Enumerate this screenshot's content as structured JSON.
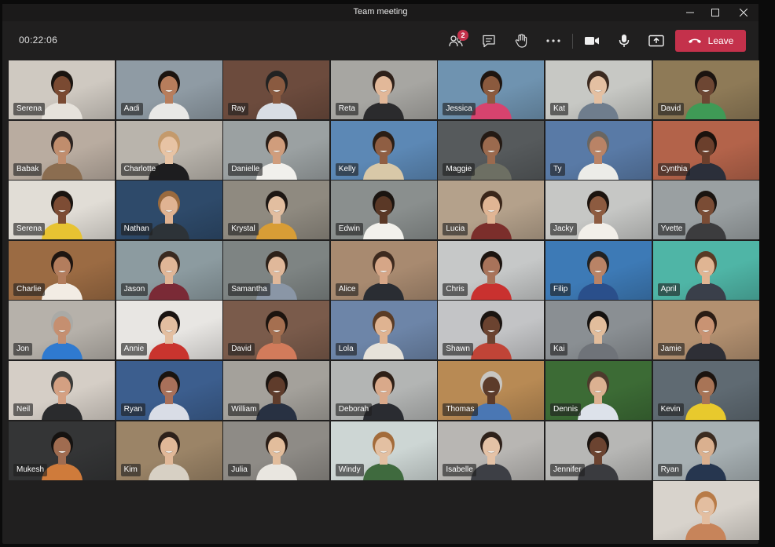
{
  "window": {
    "title": "Team meeting"
  },
  "toolbar": {
    "timer": "00:22:06",
    "participants_badge": "2",
    "leave_label": "Leave"
  },
  "colors": {
    "leave": "#c4314b",
    "badge": "#c4314b",
    "background": "#201f1f"
  },
  "icons": [
    "minimize-icon",
    "maximize-icon",
    "close-icon",
    "participants-icon",
    "chat-icon",
    "raise-hand-icon",
    "more-options-icon",
    "camera-icon",
    "microphone-icon",
    "share-screen-icon",
    "phone-hangup-icon"
  ],
  "participants": [
    {
      "name": "Serena",
      "bg": "#cfc9c1",
      "skin": "#7a4a32",
      "hair": "#1a1410",
      "shirt": "#e6e2db"
    },
    {
      "name": "Aadi",
      "bg": "#8f9ba4",
      "skin": "#b77d5c",
      "hair": "#1c140f",
      "shirt": "#e8e8e6"
    },
    {
      "name": "Ray",
      "bg": "#6c4b3d",
      "skin": "#8a5a40",
      "hair": "#222",
      "shirt": "#d8dde4"
    },
    {
      "name": "Reta",
      "bg": "#a7a6a2",
      "skin": "#e2b899",
      "hair": "#2e2019",
      "shirt": "#2b2b2d"
    },
    {
      "name": "Jessica",
      "bg": "#6f93b0",
      "skin": "#8b5a3e",
      "hair": "#1e1510",
      "shirt": "#d7436e"
    },
    {
      "name": "Kat",
      "bg": "#c7c8c4",
      "skin": "#e4c0a2",
      "hair": "#3b2a20",
      "shirt": "#6f7d8d"
    },
    {
      "name": "David",
      "bg": "#8e7a57",
      "skin": "#6d4633",
      "hair": "#1c1410",
      "shirt": "#3f9a56"
    },
    {
      "name": "Babak",
      "bg": "#b9aca0",
      "skin": "#c08d6d",
      "hair": "#2b2320",
      "shirt": "#8b6d50"
    },
    {
      "name": "Charlotte",
      "bg": "#b9b4ac",
      "skin": "#e7c3a4",
      "hair": "#c49a6c",
      "shirt": "#1d1d1f"
    },
    {
      "name": "Danielle",
      "bg": "#9ba1a2",
      "skin": "#d09d7c",
      "hair": "#2a1d16",
      "shirt": "#f1f0ec"
    },
    {
      "name": "Kelly",
      "bg": "#5c88b5",
      "skin": "#8f5e43",
      "hair": "#2b1e15",
      "shirt": "#d8c8a8"
    },
    {
      "name": "Maggie",
      "bg": "#565a5c",
      "skin": "#9b6a4e",
      "hair": "#241a14",
      "shirt": "#6d6f63"
    },
    {
      "name": "Ty",
      "bg": "#597aa6",
      "skin": "#b98366",
      "hair": "#6a6661",
      "shirt": "#ecece8"
    },
    {
      "name": "Cynthia",
      "bg": "#b3634a",
      "skin": "#6b3f2c",
      "hair": "#1b120d",
      "shirt": "#2b2f3a"
    },
    {
      "name": "Serena",
      "bg": "#e1ddd6",
      "skin": "#7d4c34",
      "hair": "#1a1410",
      "shirt": "#e7c332"
    },
    {
      "name": "Nathan",
      "bg": "#2e4a6a",
      "skin": "#e0b392",
      "hair": "#9a6a3e",
      "shirt": "#2d3338"
    },
    {
      "name": "Krystal",
      "bg": "#8f8a80",
      "skin": "#e2bea0",
      "hair": "#1d1714",
      "shirt": "#d89d36"
    },
    {
      "name": "Edwin",
      "bg": "#8a8f8e",
      "skin": "#5a3826",
      "hair": "#1a1410",
      "shirt": "#f2f1ec"
    },
    {
      "name": "Lucia",
      "bg": "#b4a18b",
      "skin": "#e0b594",
      "hair": "#3a261a",
      "shirt": "#7b2e2b"
    },
    {
      "name": "Jacky",
      "bg": "#c6c7c5",
      "skin": "#8d5b40",
      "hair": "#1c140f",
      "shirt": "#f2efe9"
    },
    {
      "name": "Yvette",
      "bg": "#9aa0a2",
      "skin": "#7a4c35",
      "hair": "#1a1410",
      "shirt": "#3c3c3e"
    },
    {
      "name": "Charlie",
      "bg": "#9b6b43",
      "skin": "#b37d5d",
      "hair": "#1e1510",
      "shirt": "#f2ece4"
    },
    {
      "name": "Jason",
      "bg": "#8c9ba0",
      "skin": "#e0b697",
      "hair": "#3a2a20",
      "shirt": "#7a2a36"
    },
    {
      "name": "Samantha",
      "bg": "#7e8483",
      "skin": "#e0b89a",
      "hair": "#2d2119",
      "shirt": "#8a96a6"
    },
    {
      "name": "Alice",
      "bg": "#a88a70",
      "skin": "#d6a687",
      "hair": "#3d2a1f",
      "shirt": "#2a2d33"
    },
    {
      "name": "Chris",
      "bg": "#c6c8c8",
      "skin": "#a8735a",
      "hair": "#1c140f",
      "shirt": "#c9312f"
    },
    {
      "name": "Filip",
      "bg": "#3d7ab6",
      "skin": "#b98366",
      "hair": "#222",
      "shirt": "#2a4f8b"
    },
    {
      "name": "April",
      "bg": "#4fb5a6",
      "skin": "#e0b593",
      "hair": "#5a3b25",
      "shirt": "#3a3f4a"
    },
    {
      "name": "Jon",
      "bg": "#b6b1aa",
      "skin": "#c58f70",
      "hair": "#aaaaa6",
      "shirt": "#2f7ad0"
    },
    {
      "name": "Annie",
      "bg": "#e8e6e3",
      "skin": "#e3bea0",
      "hair": "#1a1412",
      "shirt": "#c9342e"
    },
    {
      "name": "David",
      "bg": "#7a5b4b",
      "skin": "#a56f50",
      "hair": "#1c140f",
      "shirt": "#d27b5b"
    },
    {
      "name": "Lola",
      "bg": "#6d85a8",
      "skin": "#dfb391",
      "hair": "#5b3c25",
      "shirt": "#e6e2da"
    },
    {
      "name": "Shawn",
      "bg": "#c3c4c6",
      "skin": "#6b4330",
      "hair": "#1a1410",
      "shirt": "#c04437"
    },
    {
      "name": "Kai",
      "bg": "#8a8f93",
      "skin": "#e2bd9c",
      "hair": "#151210",
      "shirt": "#6f7379"
    },
    {
      "name": "Jamie",
      "bg": "#b29070",
      "skin": "#c99373",
      "hair": "#2b1d15",
      "shirt": "#2e2f36"
    },
    {
      "name": "Neil",
      "bg": "#d5cec6",
      "skin": "#d4a082",
      "hair": "#3a3a38",
      "shirt": "#2a2b2d"
    },
    {
      "name": "Ryan",
      "bg": "#3c5e8e",
      "skin": "#a8705a",
      "hair": "#1a1410",
      "shirt": "#d9dde6"
    },
    {
      "name": "William",
      "bg": "#a4a19b",
      "skin": "#5f3c2b",
      "hair": "#1a1410",
      "shirt": "#283142"
    },
    {
      "name": "Deborah",
      "bg": "#b3b5b4",
      "skin": "#d9a98a",
      "hair": "#2e1f16",
      "shirt": "#2a2c31"
    },
    {
      "name": "Thomas",
      "bg": "#b88a54",
      "skin": "#5c3b2a",
      "hair": "#c8c6c2",
      "shirt": "#4a77b4"
    },
    {
      "name": "Dennis",
      "bg": "#3c6b35",
      "skin": "#dcb191",
      "hair": "#4d3a2c",
      "shirt": "#dde2ea"
    },
    {
      "name": "Kevin",
      "bg": "#5f6a72",
      "skin": "#a87456",
      "hair": "#1c140f",
      "shirt": "#e8c92d"
    },
    {
      "name": "Mukesh",
      "bg": "#343536",
      "skin": "#a06c50",
      "hair": "#151210",
      "shirt": "#cf7b3b"
    },
    {
      "name": "Kim",
      "bg": "#9b8467",
      "skin": "#e1b898",
      "hair": "#2d211b",
      "shirt": "#d7d0c4"
    },
    {
      "name": "Julia",
      "bg": "#8e8b86",
      "skin": "#e2bd9c",
      "hair": "#2a1d16",
      "shirt": "#e9e6e0"
    },
    {
      "name": "Windy",
      "bg": "#cdd6d4",
      "skin": "#e3c0a2",
      "hair": "#a36b3a",
      "shirt": "#3f6a3e"
    },
    {
      "name": "Isabelle",
      "bg": "#b8b6b3",
      "skin": "#e4c2a6",
      "hair": "#2e211a",
      "shirt": "#3d3f45"
    },
    {
      "name": "Jennifer",
      "bg": "#b7b7b5",
      "skin": "#6b4330",
      "hair": "#1a1410",
      "shirt": "#3a3b3f"
    },
    {
      "name": "Ryan",
      "bg": "#a7b0b3",
      "skin": "#dab08f",
      "hair": "#3b2b20",
      "shirt": "#26364f"
    },
    {
      "name": "",
      "bg": "#d8d3cc",
      "skin": "#e3bea0",
      "hair": "#b87b47",
      "shirt": "#c7845a"
    }
  ]
}
